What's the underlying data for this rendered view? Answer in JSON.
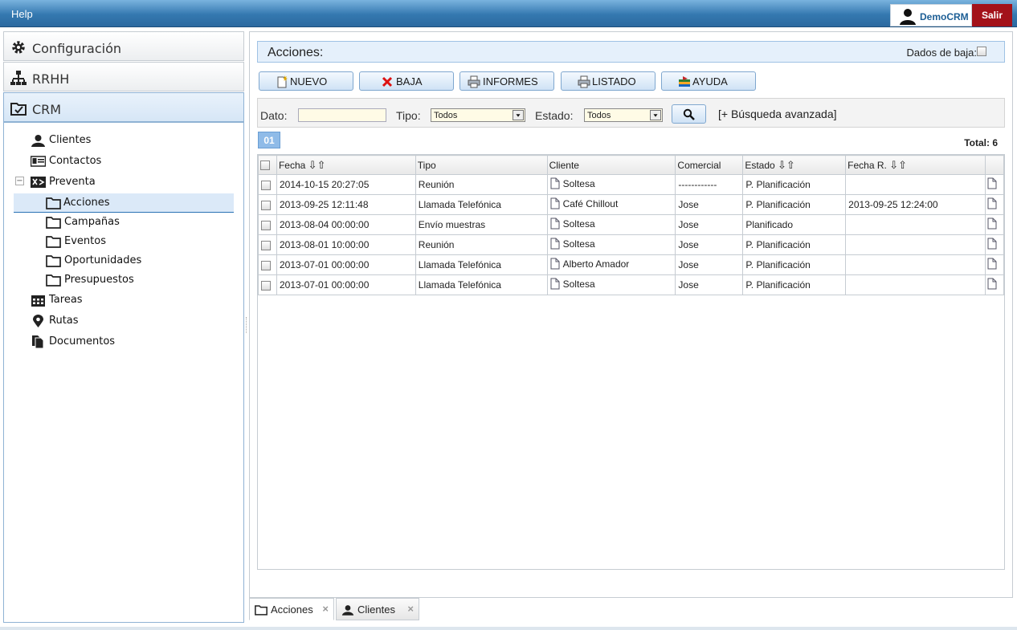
{
  "topbar": {
    "help_label": "Help",
    "user_name": "DemoCRM",
    "logout_label": "Salir"
  },
  "sidebar": {
    "sections": [
      {
        "label": "Configuración",
        "icon": "gear-icon"
      },
      {
        "label": "RRHH",
        "icon": "org-chart-icon"
      },
      {
        "label": "CRM",
        "icon": "folder-check-icon"
      }
    ],
    "tree": [
      {
        "label": "Clientes",
        "icon": "person-icon"
      },
      {
        "label": "Contactos",
        "icon": "contact-card-icon"
      },
      {
        "label": "Preventa",
        "icon": "shuffle-icon"
      },
      {
        "label": "Acciones",
        "icon": "folder-icon"
      },
      {
        "label": "Campañas",
        "icon": "folder-icon"
      },
      {
        "label": "Eventos",
        "icon": "folder-icon"
      },
      {
        "label": "Oportunidades",
        "icon": "folder-icon"
      },
      {
        "label": "Presupuestos",
        "icon": "folder-icon"
      },
      {
        "label": "Tareas",
        "icon": "calendar-icon"
      },
      {
        "label": "Rutas",
        "icon": "map-pin-icon"
      },
      {
        "label": "Documentos",
        "icon": "documents-icon"
      }
    ],
    "collapse_symbol": "−"
  },
  "main": {
    "title": "Acciones:",
    "dados_baja_label": "Dados de baja:",
    "buttons": [
      {
        "label": "NUEVO",
        "icon": "new-doc-icon"
      },
      {
        "label": "BAJA",
        "icon": "x-icon"
      },
      {
        "label": "INFORMES",
        "icon": "printer-icon"
      },
      {
        "label": "LISTADO",
        "icon": "printer-icon"
      },
      {
        "label": "AYUDA",
        "icon": "help-book-icon"
      }
    ],
    "filters": {
      "dato_label": "Dato:",
      "dato_value": "",
      "tipo_label": "Tipo:",
      "tipo_value": "Todos",
      "estado_label": "Estado:",
      "estado_value": "Todos",
      "advanced_label": "[+ Búsqueda avanzada]"
    },
    "page_label": "01",
    "total_label": "Total: 6",
    "table": {
      "columns": [
        "Fecha",
        "Tipo",
        "Cliente",
        "Comercial",
        "Estado",
        "Fecha R."
      ],
      "sort_arrows": "⇩⇧",
      "rows": [
        {
          "fecha": "2014-10-15 20:27:05",
          "tipo": "Reunión",
          "cliente": "Soltesa",
          "comercial": "------------",
          "estado": "P. Planificación",
          "fecha_r": ""
        },
        {
          "fecha": "2013-09-25 12:11:48",
          "tipo": "Llamada Telefónica",
          "cliente": "Café Chillout",
          "comercial": "Jose",
          "estado": "P. Planificación",
          "fecha_r": "2013-09-25 12:24:00"
        },
        {
          "fecha": "2013-08-04 00:00:00",
          "tipo": "Envío muestras",
          "cliente": "Soltesa",
          "comercial": "Jose",
          "estado": "Planificado",
          "fecha_r": ""
        },
        {
          "fecha": "2013-08-01 10:00:00",
          "tipo": "Reunión",
          "cliente": "Soltesa",
          "comercial": "Jose",
          "estado": "P. Planificación",
          "fecha_r": ""
        },
        {
          "fecha": "2013-07-01 00:00:00",
          "tipo": "Llamada Telefónica",
          "cliente": "Alberto Amador",
          "comercial": "Jose",
          "estado": "P. Planificación",
          "fecha_r": ""
        },
        {
          "fecha": "2013-07-01 00:00:00",
          "tipo": "Llamada Telefónica",
          "cliente": "Soltesa",
          "comercial": "Jose",
          "estado": "P. Planificación",
          "fecha_r": ""
        }
      ]
    }
  },
  "tabs": [
    {
      "label": "Acciones",
      "close": "×"
    },
    {
      "label": "Clientes",
      "close": "×"
    }
  ],
  "colors": {
    "accent": "#2c6aa0",
    "logout": "#a3121a",
    "selection": "#dbe9f8"
  }
}
